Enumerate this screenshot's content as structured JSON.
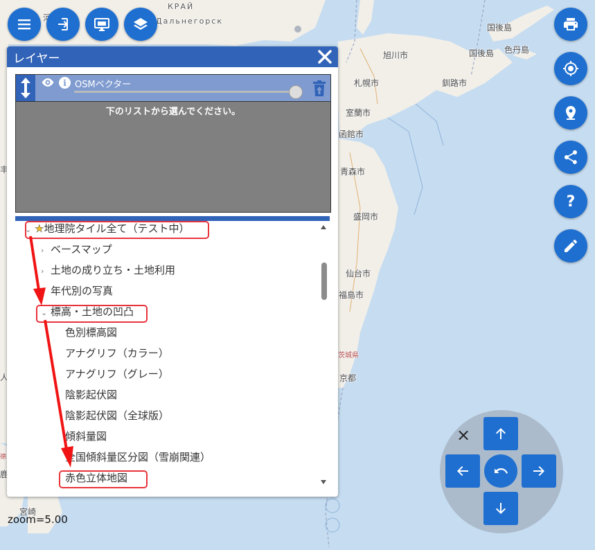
{
  "map": {
    "labels": {
      "dalnegorsk": "Дальнегорск",
      "krai": "КРАЙ",
      "kunashiri": "国後島",
      "kunashiri2": "国後島",
      "shikotan": "色丹島",
      "asahikawa": "旭川市",
      "kushiro": "釧路市",
      "sapporo": "札幌市",
      "muroran": "室蘭市",
      "hakodate": "函館市",
      "aomori": "青森市",
      "morioka": "盛岡市",
      "sendai": "仙台市",
      "fukushima": "福島市",
      "ibaraki": "茨城県",
      "tokyo": "京都",
      "miyazaki": "宮崎",
      "left1": "河",
      "left2": "丰",
      "left3": "人",
      "left4": "德",
      "left5": "鹿"
    }
  },
  "toolbar": {
    "menu_icon": "menu-icon",
    "login_icon": "login-icon",
    "screen_icon": "monitor-icon",
    "layers_icon": "layers-icon",
    "print_icon": "print-icon",
    "location_icon": "location-icon",
    "pin_icon": "map-pin-icon",
    "share_icon": "share-icon",
    "help_label": "?",
    "edit_icon": "pencil-icon"
  },
  "panel": {
    "title": "レイヤー",
    "active_layer": {
      "name": "OSMベクター",
      "opacity": 1.0
    },
    "hint": "下のリストから選んでください。",
    "tree": [
      {
        "label": "地理院タイル全て（テスト中）",
        "level": 0,
        "expanded": true,
        "highlighted": true,
        "star": true
      },
      {
        "label": "ベースマップ",
        "level": 1,
        "expanded": false
      },
      {
        "label": "土地の成り立ち・土地利用",
        "level": 1,
        "expanded": false
      },
      {
        "label": "年代別の写真",
        "level": 1,
        "expanded": false
      },
      {
        "label": "標高・土地の凹凸",
        "level": 1,
        "expanded": true,
        "highlighted": true
      },
      {
        "label": "色別標高図",
        "level": 2
      },
      {
        "label": "アナグリフ（カラー）",
        "level": 2
      },
      {
        "label": "アナグリフ（グレー）",
        "level": 2
      },
      {
        "label": "陰影起伏図",
        "level": 2
      },
      {
        "label": "陰影起伏図（全球版）",
        "level": 2
      },
      {
        "label": "傾斜量図",
        "level": 2
      },
      {
        "label": "全国傾斜量区分図（雪崩関連）",
        "level": 2
      },
      {
        "label": "赤色立体地図",
        "level": 2,
        "highlighted": true
      }
    ]
  },
  "zoom": {
    "readout": "zoom=5.00"
  },
  "nav": {
    "close_label": "×"
  },
  "colors": {
    "accent": "#1f6fd0",
    "panel_header": "#3163b8",
    "highlight": "#e8333a",
    "sea": "#c6dcf0",
    "land": "#f2efe9"
  }
}
